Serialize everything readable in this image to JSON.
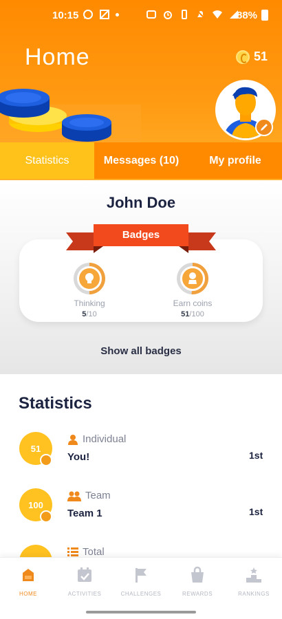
{
  "status_bar": {
    "time": "10:15",
    "battery": "88%",
    "icons_left": [
      "whatsapp-icon",
      "image-icon",
      "dot-icon"
    ],
    "icons_right": [
      "nfc-icon",
      "alarm-icon",
      "vibrate-icon",
      "mute-icon",
      "wifi-icon",
      "signal-icon",
      "battery-icon"
    ]
  },
  "header": {
    "title": "Home",
    "coins": "51",
    "accent": "#ff8a00"
  },
  "tabs": [
    {
      "label": "Statistics",
      "active": true
    },
    {
      "label": "Messages (10)",
      "active": false
    },
    {
      "label": "My profile",
      "active": false
    }
  ],
  "profile": {
    "name": "John Doe",
    "badges_title": "Badges",
    "badges": [
      {
        "name": "Thinking",
        "current": "5",
        "total": "/10",
        "icon": "lightbulb-icon"
      },
      {
        "name": "Earn coins",
        "current": "51",
        "total": "/100",
        "icon": "coin-hand-icon"
      }
    ],
    "show_all": "Show all badges"
  },
  "statistics": {
    "title": "Statistics",
    "rows": [
      {
        "value": "51",
        "category": "Individual",
        "category_icon": "person-icon",
        "name": "You!",
        "rank": "1st"
      },
      {
        "value": "100",
        "category": "Team",
        "category_icon": "group-icon",
        "name": "Team 1",
        "rank": "1st"
      },
      {
        "value": "",
        "category": "Total",
        "category_icon": "list-icon",
        "name": "",
        "rank": ""
      }
    ]
  },
  "bottom_nav": [
    {
      "label": "HOME",
      "icon": "home-icon",
      "active": true
    },
    {
      "label": "ACTIVITIES",
      "icon": "calendar-check-icon",
      "active": false
    },
    {
      "label": "CHALLENGES",
      "icon": "flag-icon",
      "active": false
    },
    {
      "label": "REWARDS",
      "icon": "bag-icon",
      "active": false
    },
    {
      "label": "RANKINGS",
      "icon": "podium-icon",
      "active": false
    }
  ]
}
